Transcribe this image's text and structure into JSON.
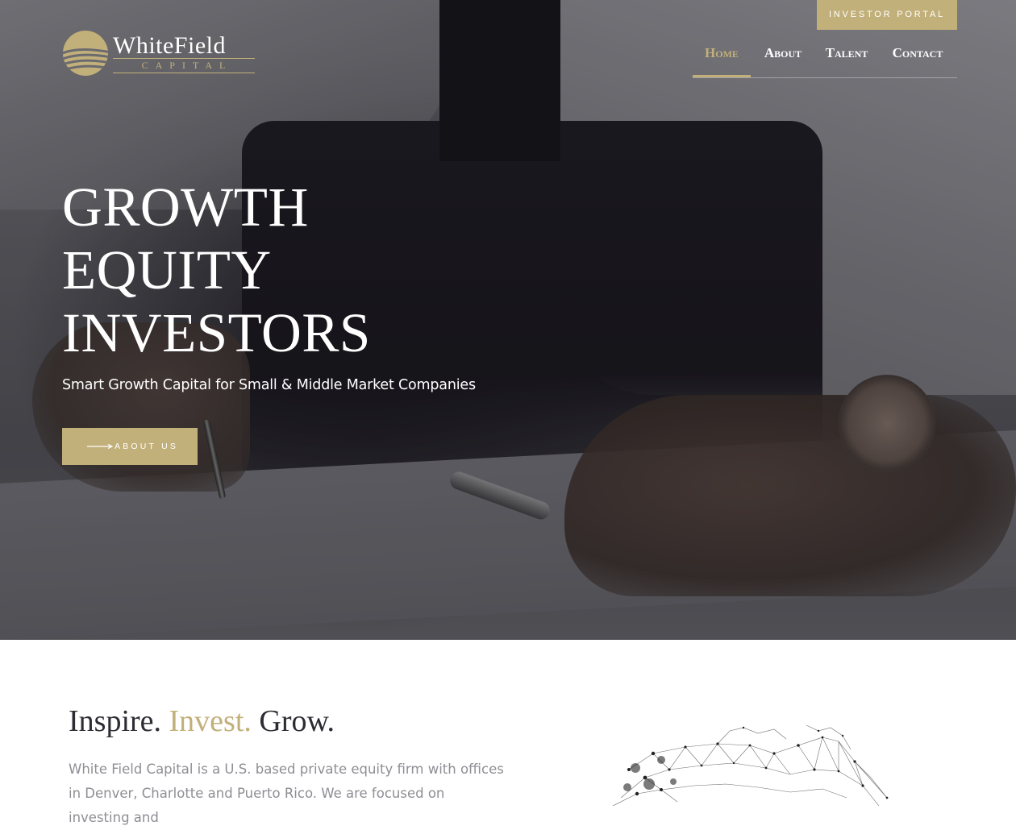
{
  "header": {
    "logo": {
      "word": "WhiteField",
      "sub": "Capital"
    },
    "investor_portal": "INVESTOR PORTAL",
    "nav": [
      {
        "label": "Home"
      },
      {
        "label": "About"
      },
      {
        "label": "Talent"
      },
      {
        "label": "Contact"
      }
    ]
  },
  "hero": {
    "title_lines": [
      "GROWTH",
      "EQUITY",
      "INVESTORS"
    ],
    "subtitle": "Smart Growth Capital for Small & Middle Market Companies",
    "cta": "ABOUT US"
  },
  "intro": {
    "tagline": {
      "a": "Inspire.",
      "b": "Invest.",
      "c": "Grow."
    },
    "body": "White Field Capital is a U.S. based private equity firm with offices in Denver, Charlotte and Puerto Rico. We are focused on investing and"
  },
  "colors": {
    "gold": "#c2b07a",
    "dark": "#2c2c33",
    "muted": "#8e8e94"
  },
  "icons": [
    "arrow-right-icon",
    "logo-emblem-icon",
    "network-globe-graphic"
  ]
}
